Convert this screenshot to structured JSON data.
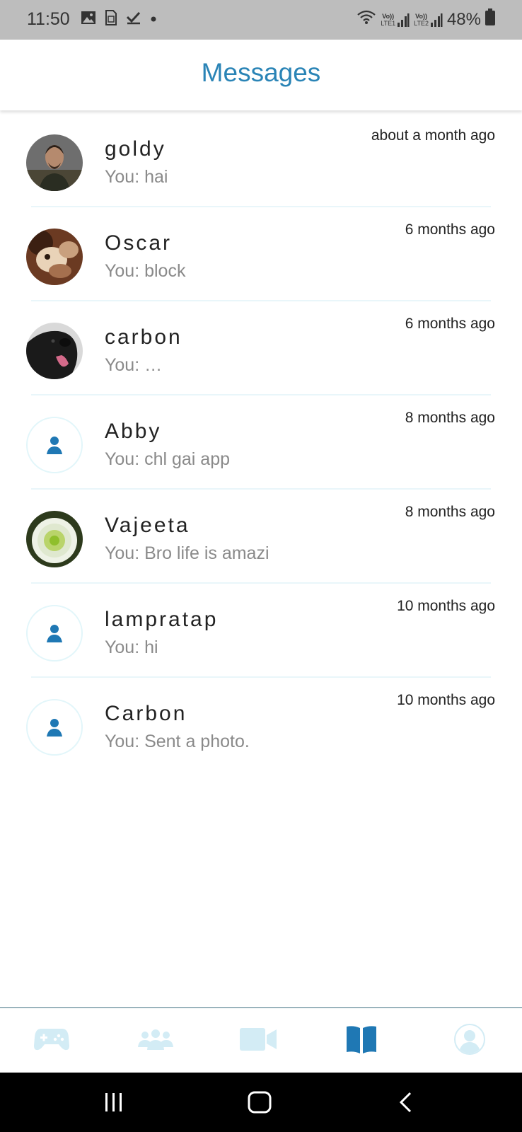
{
  "status_bar": {
    "time": "11:50",
    "battery": "48%",
    "left_icons": [
      "image-icon",
      "sim-card-icon",
      "check-icon",
      "dot-icon"
    ],
    "right_icons": [
      "wifi-icon",
      "volte-lte1-signal-icon",
      "volte-lte2-signal-icon",
      "battery-icon"
    ],
    "lte1_label": "LTE1",
    "lte2_label": "LTE2"
  },
  "header": {
    "title": "Messages"
  },
  "conversations": [
    {
      "name": "goldy",
      "preview": "You: hai",
      "time": "about a month ago",
      "avatar": "photo-person"
    },
    {
      "name": "Oscar",
      "preview": "You: block",
      "time": "6 months ago",
      "avatar": "photo-pet"
    },
    {
      "name": "carbon",
      "preview": "You: …",
      "time": "6 months ago",
      "avatar": "photo-dog"
    },
    {
      "name": "Abby",
      "preview": "You: chl gai app",
      "time": "8 months ago",
      "avatar": "default-user-icon"
    },
    {
      "name": "Vajeeta",
      "preview": "You: Bro life is amazi",
      "time": "8 months ago",
      "avatar": "photo-flower"
    },
    {
      "name": "lampratap",
      "preview": "You: hi",
      "time": "10 months ago",
      "avatar": "default-user-icon"
    },
    {
      "name": "Carbon",
      "preview": "You: Sent a photo.",
      "time": "10 months ago",
      "avatar": "default-user-icon"
    }
  ],
  "bottom_nav": {
    "items": [
      "gamepad-icon",
      "friends-icon",
      "video-icon",
      "book-icon",
      "profile-icon"
    ],
    "active": "book-icon",
    "active_color": "#1f78b4",
    "inactive_color": "#d3ecf5"
  },
  "system_nav": [
    "recents-icon",
    "home-icon",
    "back-icon"
  ],
  "colors": {
    "accent": "#2a84b6",
    "divider": "#e9f6fa",
    "statusbar": "#bdbdbd"
  }
}
